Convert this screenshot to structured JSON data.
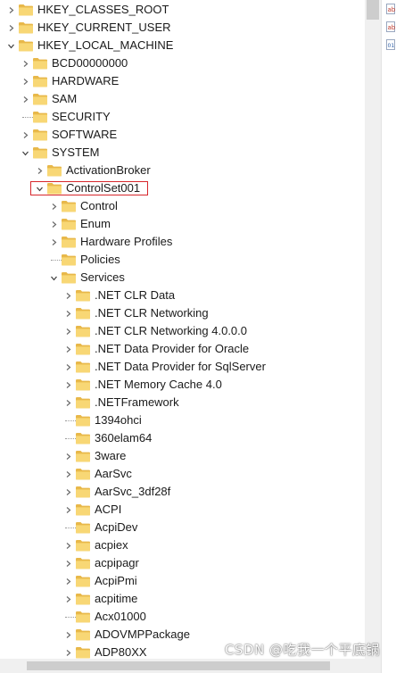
{
  "tree": {
    "nodes": [
      {
        "label": "HKEY_CLASSES_ROOT",
        "state": "collapsed",
        "level": 0
      },
      {
        "label": "HKEY_CURRENT_USER",
        "state": "collapsed",
        "level": 0
      },
      {
        "label": "HKEY_LOCAL_MACHINE",
        "state": "expanded",
        "level": 0
      },
      {
        "label": "BCD00000000",
        "state": "collapsed",
        "level": 1
      },
      {
        "label": "HARDWARE",
        "state": "collapsed",
        "level": 1
      },
      {
        "label": "SAM",
        "state": "collapsed",
        "level": 1
      },
      {
        "label": "SECURITY",
        "state": "leaf",
        "level": 1
      },
      {
        "label": "SOFTWARE",
        "state": "collapsed",
        "level": 1
      },
      {
        "label": "SYSTEM",
        "state": "expanded",
        "level": 1
      },
      {
        "label": "ActivationBroker",
        "state": "collapsed",
        "level": 2
      },
      {
        "label": "ControlSet001",
        "state": "expanded",
        "level": 2,
        "highlighted": true
      },
      {
        "label": "Control",
        "state": "collapsed",
        "level": 3
      },
      {
        "label": "Enum",
        "state": "collapsed",
        "level": 3
      },
      {
        "label": "Hardware Profiles",
        "state": "collapsed",
        "level": 3
      },
      {
        "label": "Policies",
        "state": "leaf",
        "level": 3
      },
      {
        "label": "Services",
        "state": "expanded",
        "level": 3
      },
      {
        "label": ".NET CLR Data",
        "state": "collapsed",
        "level": 4
      },
      {
        "label": ".NET CLR Networking",
        "state": "collapsed",
        "level": 4
      },
      {
        "label": ".NET CLR Networking 4.0.0.0",
        "state": "collapsed",
        "level": 4
      },
      {
        "label": ".NET Data Provider for Oracle",
        "state": "collapsed",
        "level": 4
      },
      {
        "label": ".NET Data Provider for SqlServer",
        "state": "collapsed",
        "level": 4
      },
      {
        "label": ".NET Memory Cache 4.0",
        "state": "collapsed",
        "level": 4
      },
      {
        "label": ".NETFramework",
        "state": "collapsed",
        "level": 4
      },
      {
        "label": "1394ohci",
        "state": "leaf",
        "level": 4
      },
      {
        "label": "360elam64",
        "state": "leaf",
        "level": 4
      },
      {
        "label": "3ware",
        "state": "collapsed",
        "level": 4
      },
      {
        "label": "AarSvc",
        "state": "collapsed",
        "level": 4
      },
      {
        "label": "AarSvc_3df28f",
        "state": "collapsed",
        "level": 4
      },
      {
        "label": "ACPI",
        "state": "collapsed",
        "level": 4
      },
      {
        "label": "AcpiDev",
        "state": "leaf",
        "level": 4
      },
      {
        "label": "acpiex",
        "state": "collapsed",
        "level": 4
      },
      {
        "label": "acpipagr",
        "state": "collapsed",
        "level": 4
      },
      {
        "label": "AcpiPmi",
        "state": "collapsed",
        "level": 4
      },
      {
        "label": "acpitime",
        "state": "collapsed",
        "level": 4
      },
      {
        "label": "Acx01000",
        "state": "leaf",
        "level": 4
      },
      {
        "label": "ADOVMPPackage",
        "state": "collapsed",
        "level": 4
      },
      {
        "label": "ADP80XX",
        "state": "collapsed",
        "level": 4
      }
    ]
  },
  "watermark": "CSDN @吃我一个平底锅",
  "colors": {
    "folder_body": "#f8d775",
    "folder_tab": "#e8b84a",
    "highlight_border": "#d7262b",
    "text": "#1a1a1a"
  }
}
